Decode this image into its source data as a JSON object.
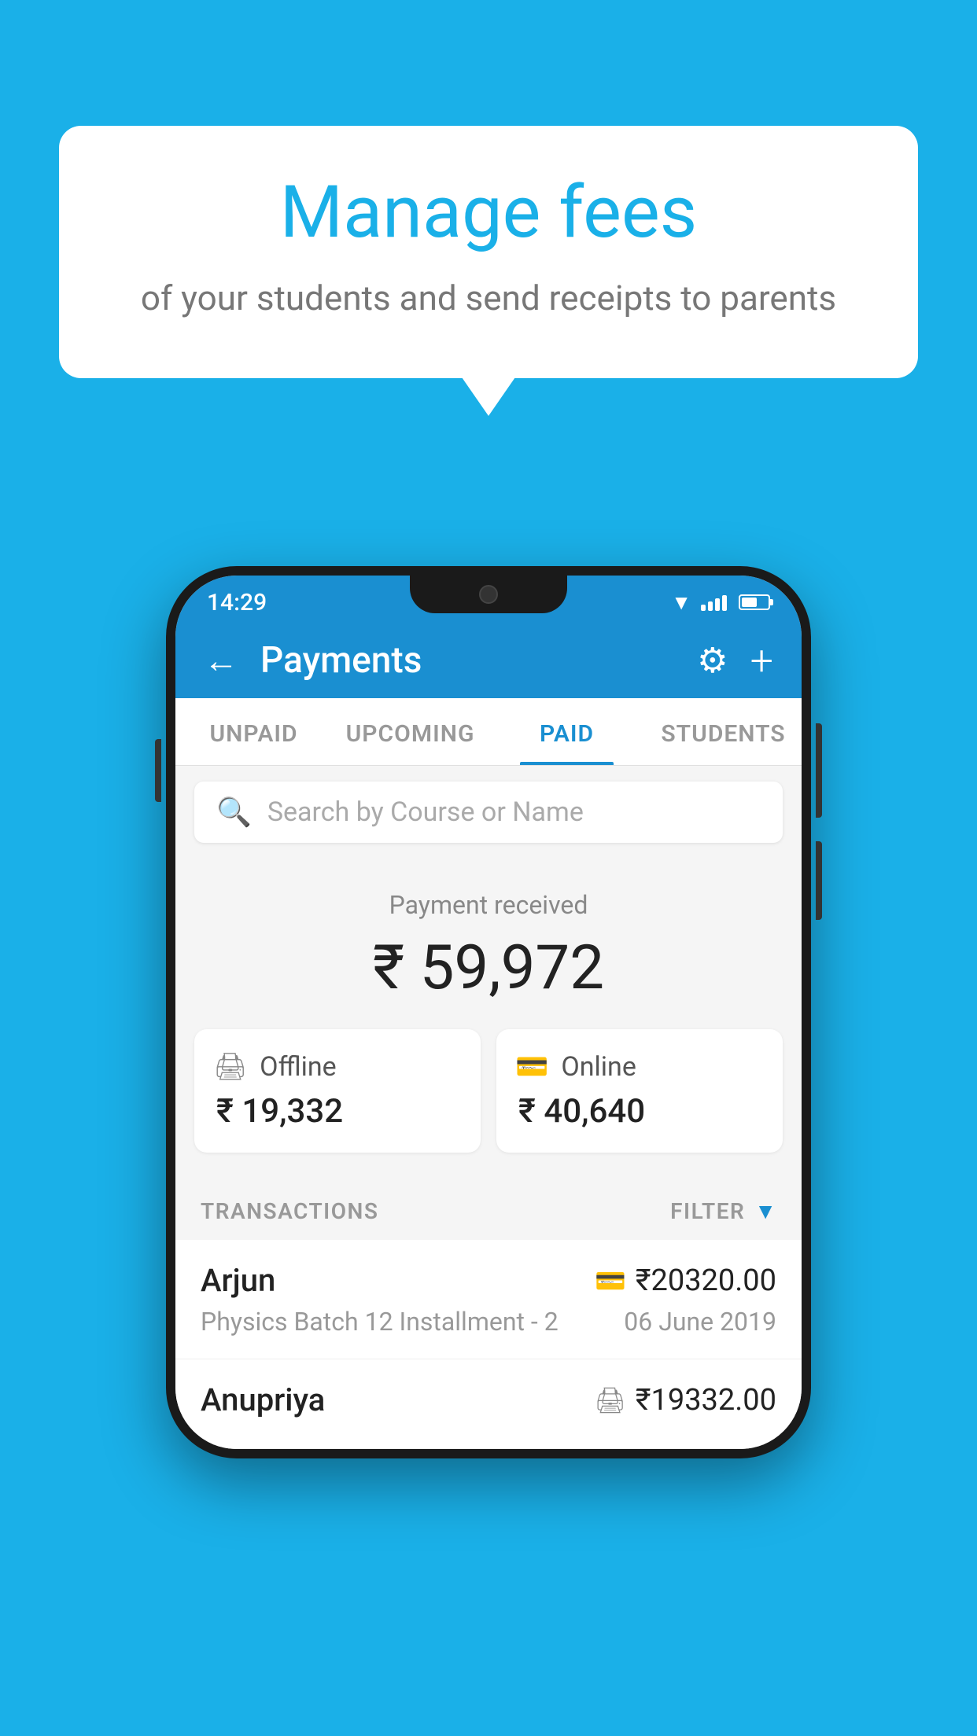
{
  "background_color": "#1ab0e8",
  "speech_bubble": {
    "title": "Manage fees",
    "subtitle": "of your students and send receipts to parents"
  },
  "status_bar": {
    "time": "14:29"
  },
  "header": {
    "title": "Payments",
    "back_label": "←",
    "gear_label": "⚙",
    "plus_label": "+"
  },
  "tabs": [
    {
      "label": "UNPAID",
      "active": false
    },
    {
      "label": "UPCOMING",
      "active": false
    },
    {
      "label": "PAID",
      "active": true
    },
    {
      "label": "STUDENTS",
      "active": false
    }
  ],
  "search": {
    "placeholder": "Search by Course or Name"
  },
  "payment_summary": {
    "received_label": "Payment received",
    "total_amount": "₹ 59,972",
    "offline": {
      "label": "Offline",
      "amount": "₹ 19,332"
    },
    "online": {
      "label": "Online",
      "amount": "₹ 40,640"
    }
  },
  "transactions": {
    "header_label": "TRANSACTIONS",
    "filter_label": "FILTER",
    "rows": [
      {
        "name": "Arjun",
        "description": "Physics Batch 12 Installment - 2",
        "amount": "₹20320.00",
        "date": "06 June 2019",
        "icon_type": "card"
      },
      {
        "name": "Anupriya",
        "description": "",
        "amount": "₹19332.00",
        "date": "",
        "icon_type": "cash"
      }
    ]
  }
}
